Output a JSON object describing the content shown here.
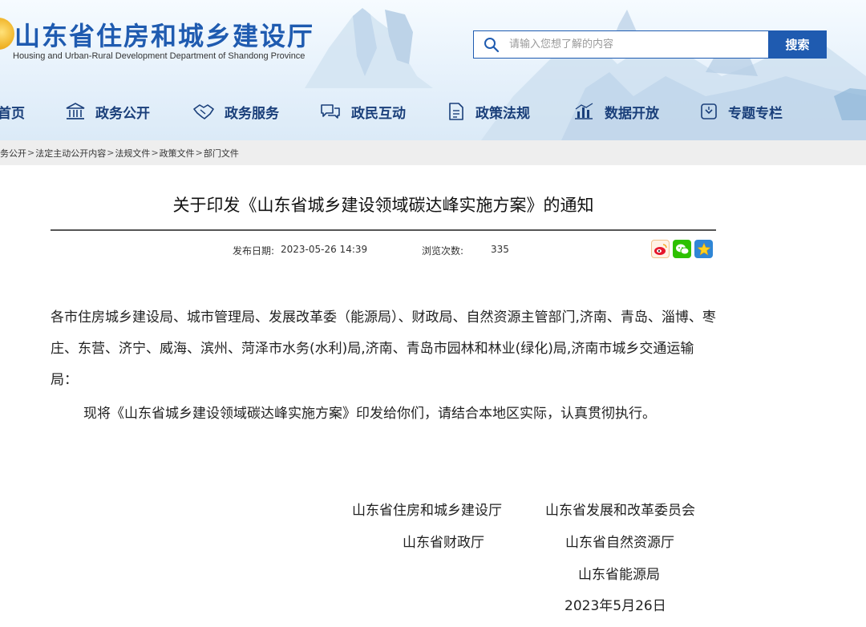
{
  "header": {
    "title_cn": "山东省住房和城乡建设厅",
    "title_en": "Housing and Urban-Rural Development Department of Shandong Province",
    "search": {
      "placeholder": "请输入您想了解的内容",
      "button_label": "搜索"
    },
    "colors": {
      "brand": "#1f5bb0",
      "nav_text": "#1a3f7a"
    }
  },
  "nav": {
    "items": [
      {
        "label": "首页",
        "icon": "home-icon"
      },
      {
        "label": "政务公开",
        "icon": "government-building-icon"
      },
      {
        "label": "政务服务",
        "icon": "handshake-icon"
      },
      {
        "label": "政民互动",
        "icon": "chat-bubbles-icon"
      },
      {
        "label": "政策法规",
        "icon": "document-icon"
      },
      {
        "label": "数据开放",
        "icon": "bar-chart-icon"
      },
      {
        "label": "专题专栏",
        "icon": "folder-icon"
      }
    ]
  },
  "breadcrumb": {
    "items": [
      "务公开",
      "法定主动公开内容",
      "法规文件",
      "政策文件",
      "部门文件"
    ],
    "separator": ">"
  },
  "article": {
    "title": "关于印发《山东省城乡建设领域碳达峰实施方案》的通知",
    "publish_label": "发布日期:",
    "publish_date": "2023-05-26 14:39",
    "views_label": "浏览次数:",
    "views": "335",
    "share_icons": [
      "weibo-icon",
      "wechat-icon",
      "favorite-star-icon"
    ],
    "addressee": "各市住房城乡建设局、城市管理局、发展改革委（能源局）、财政局、自然资源主管部门,济南、青岛、淄博、枣庄、东营、济宁、威海、滨州、菏泽市水务(水利)局,济南、青岛市园林和林业(绿化)局,济南市城乡交通运输局：",
    "body": "现将《山东省城乡建设领域碳达峰实施方案》印发给你们，请结合本地区实际，认真贯彻执行。",
    "signatories": {
      "row1_left": "山东省住房和城乡建设厅",
      "row1_right": "山东省发展和改革委员会",
      "row2_left": "山东省财政厅",
      "row2_right": "山东省自然资源厅",
      "row3": "山东省能源局",
      "date": "2023年5月26日"
    }
  }
}
